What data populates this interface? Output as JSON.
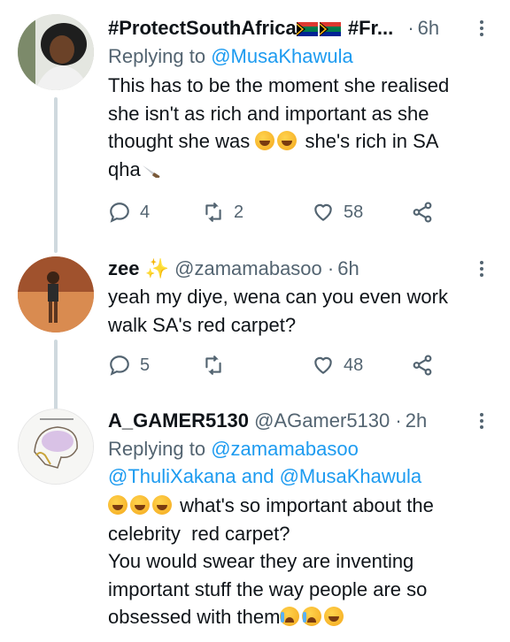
{
  "tweets": [
    {
      "author_name": "#ProtectSouthAfrica",
      "author_name_rest": " #Fr...",
      "dot": "·",
      "time": "6h",
      "replying_prefix": "Replying to ",
      "replying_to": "@MusaKhawula",
      "text_lines": [
        "This has to be the moment she realised",
        "she isn't as rich and important as she",
        "thought she was",
        "she's rich in SA",
        "qha"
      ],
      "replies": "4",
      "retweets": "2",
      "likes": "58"
    },
    {
      "author_name": "zee",
      "author_sparkle": "✨",
      "handle": "@zamamabasoo",
      "dot": "·",
      "time": "6h",
      "text_lines": [
        "yeah my diye, wena can you even work",
        "walk SA's red carpet?"
      ],
      "replies": "5",
      "retweets": "",
      "likes": "48"
    },
    {
      "author_name": "A_GAMER5130",
      "handle": "@AGamer5130",
      "dot": "·",
      "time": "2h",
      "replying_prefix": "Replying to ",
      "replying_to": "@zamamabasoo",
      "replying_to_2": "@ThuliXakana",
      "replying_and": " and ",
      "replying_to_3": "@MusaKhawula",
      "text_lines": [
        "what's so important about the",
        "celebrity  red carpet?",
        "You would swear they are inventing",
        "important stuff the way people are so",
        "obsessed with them"
      ]
    }
  ],
  "colors": {
    "link": "#1d9bf0",
    "secondary": "#536471",
    "thread_line": "#cfd9de"
  },
  "icons": [
    "reply-icon",
    "retweet-icon",
    "like-icon",
    "share-icon",
    "more-icon"
  ]
}
